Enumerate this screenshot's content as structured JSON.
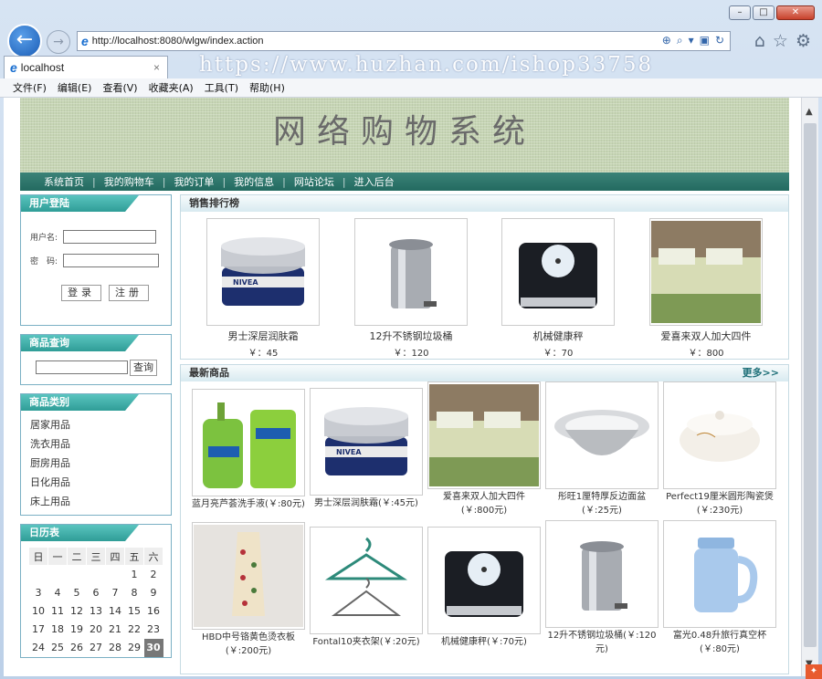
{
  "browser": {
    "address": "http://localhost:8080/wlgw/index.action",
    "tab_title": "localhost",
    "tab_close": "×",
    "watermark": "https://www.huzhan.com/ishop33758",
    "window_controls": {
      "minimize": "–",
      "maximize": "□",
      "close": "✕"
    },
    "menu": [
      "文件(F)",
      "编辑(E)",
      "查看(V)",
      "收藏夹(A)",
      "工具(T)",
      "帮助(H)"
    ]
  },
  "site": {
    "title": "网络购物系统",
    "nav": [
      "系统首页",
      "我的购物车",
      "我的订单",
      "我的信息",
      "网站论坛",
      "进入后台"
    ]
  },
  "login": {
    "heading": "用户登陆",
    "username_label": "用户名:",
    "password_label": "密　码:",
    "login_button": "登录",
    "register_button": "注册"
  },
  "search": {
    "heading": "商品查询",
    "button": "查询"
  },
  "categories": {
    "heading": "商品类别",
    "items": [
      "居家用品",
      "洗衣用品",
      "厨房用品",
      "日化用品",
      "床上用品"
    ]
  },
  "calendar": {
    "heading": "日历表",
    "weekdays": [
      "日",
      "一",
      "二",
      "三",
      "四",
      "五",
      "六"
    ],
    "rows": [
      [
        "",
        "",
        "",
        "",
        "",
        "1",
        "2"
      ],
      [
        "3",
        "4",
        "5",
        "6",
        "7",
        "8",
        "9"
      ],
      [
        "10",
        "11",
        "12",
        "13",
        "14",
        "15",
        "16"
      ],
      [
        "17",
        "18",
        "19",
        "20",
        "21",
        "22",
        "23"
      ],
      [
        "24",
        "25",
        "26",
        "27",
        "28",
        "29",
        "30"
      ]
    ],
    "today": "30"
  },
  "sales": {
    "heading": "销售排行榜",
    "items": [
      {
        "name": "男士深层润肤霜",
        "price": "￥：45"
      },
      {
        "name": "12升不锈钢垃圾桶",
        "price": "￥：120"
      },
      {
        "name": "机械健康秤",
        "price": "￥：70"
      },
      {
        "name": "爱喜来双人加大四件",
        "price": "￥：800"
      }
    ]
  },
  "newest": {
    "heading": "最新商品",
    "more": "更多>>",
    "items": [
      {
        "line1": "蓝月亮芦荟洗手液(￥:80元)",
        "line2": ""
      },
      {
        "line1": "男士深层润肤霜(￥:45元)",
        "line2": ""
      },
      {
        "line1": "爱喜来双人加大四件",
        "line2": "(￥:800元)"
      },
      {
        "line1": "彤旺1厘特厚反边面盆",
        "line2": "(￥:25元)"
      },
      {
        "line1": "Perfect19厘米圆形陶瓷煲",
        "line2": "(￥:230元)"
      },
      {
        "line1": "HBD中号铬黄色烫衣板",
        "line2": "(￥:200元)"
      },
      {
        "line1": "Fontal10夹衣架(￥:20元)",
        "line2": ""
      },
      {
        "line1": "机械健康秤(￥:70元)",
        "line2": ""
      },
      {
        "line1": "12升不锈钢垃圾桶(￥:120",
        "line2": "元)"
      },
      {
        "line1": "富光0.48升旅行真空杯",
        "line2": "(￥:80元)"
      }
    ]
  },
  "colors": {
    "accent": "#2f9d97",
    "nav": "#2d786d"
  }
}
